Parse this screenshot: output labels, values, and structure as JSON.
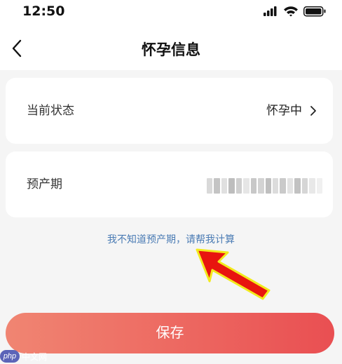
{
  "status_bar": {
    "time": "12:50",
    "icons": [
      "cellular-signal-icon",
      "wifi-icon",
      "battery-icon"
    ]
  },
  "nav": {
    "title": "怀孕信息",
    "back_icon": "chevron-left-icon"
  },
  "state_row": {
    "label": "当前状态",
    "value": "怀孕中",
    "icon": "chevron-right-icon"
  },
  "due_date_row": {
    "label": "预产期"
  },
  "help_link": "我不知道预产期，请帮我计算",
  "save_button": "保存",
  "watermark": {
    "logo": "php",
    "text": "中文网"
  },
  "colors": {
    "background": "#f5f5f5",
    "card": "#ffffff",
    "link": "#4a7bb4",
    "button_gradient_start": "#f08572",
    "button_gradient_end": "#e94f52",
    "annotation_arrow": "#e8150f"
  }
}
